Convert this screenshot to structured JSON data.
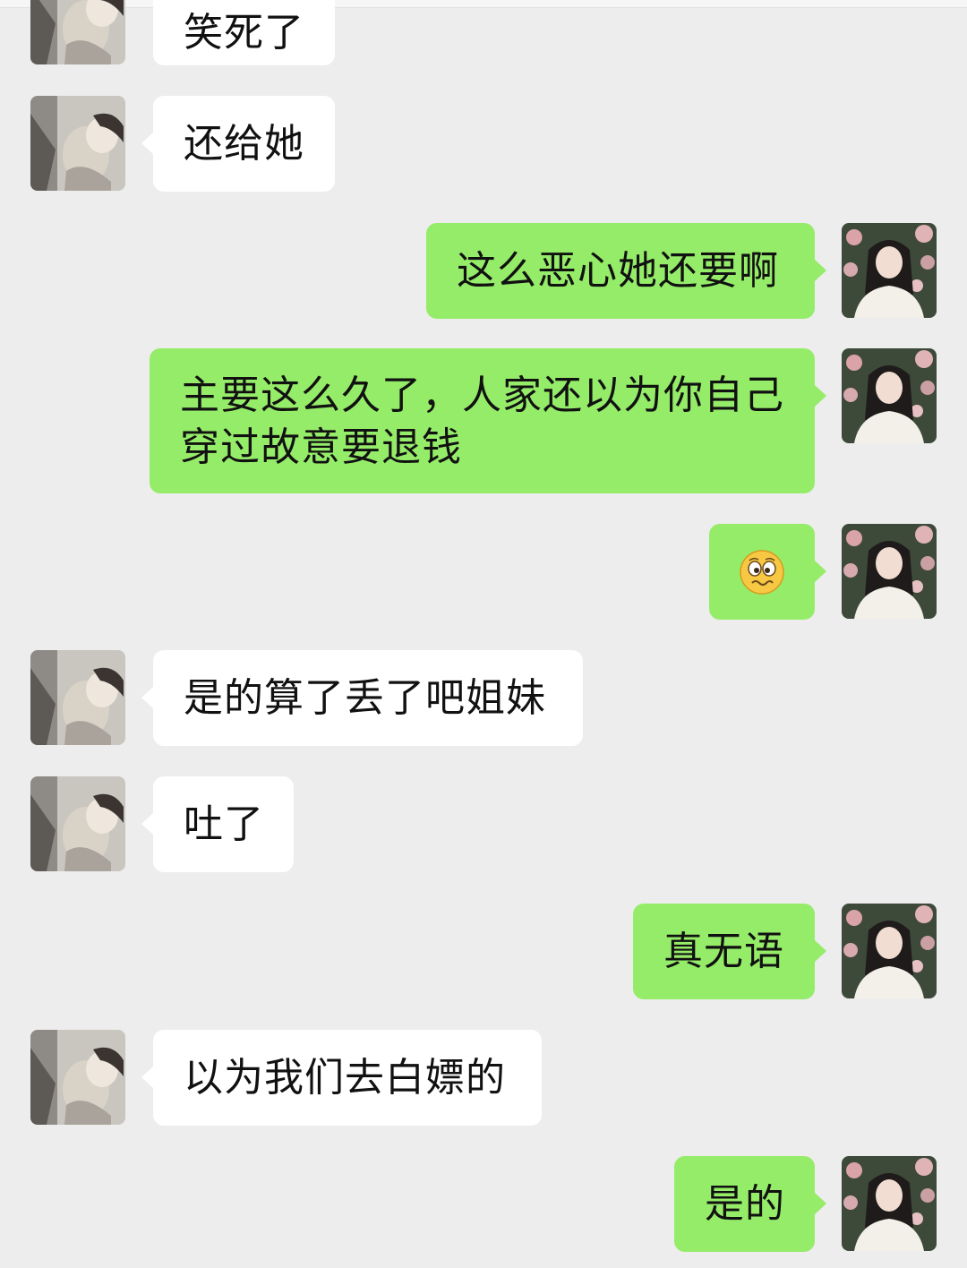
{
  "colors": {
    "background": "#ededed",
    "incoming_bubble": "#ffffff",
    "outgoing_bubble": "#95ec69"
  },
  "messages": [
    {
      "side": "in",
      "text": "笑死了"
    },
    {
      "side": "in",
      "text": "还给她"
    },
    {
      "side": "out",
      "text": "这么恶心她还要啊"
    },
    {
      "side": "out",
      "text": "主要这么久了，人家还以为你自己穿过故意要退钱"
    },
    {
      "side": "out",
      "emoji": "woozy-face-emoji"
    },
    {
      "side": "in",
      "text": "是的算了丢了吧姐妹"
    },
    {
      "side": "in",
      "text": "吐了"
    },
    {
      "side": "out",
      "text": "真无语"
    },
    {
      "side": "in",
      "text": "以为我们去白嫖的"
    },
    {
      "side": "out",
      "text": "是的"
    }
  ],
  "avatars": {
    "contact": "contact-avatar",
    "self": "self-avatar"
  }
}
